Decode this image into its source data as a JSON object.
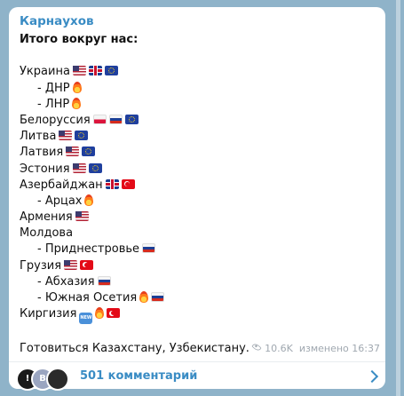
{
  "post": {
    "author": "Карнаухов",
    "lines": [
      {
        "text": "Итого вокруг нас:",
        "style": "bold",
        "marks": []
      },
      {
        "text": "",
        "style": "normal",
        "marks": []
      },
      {
        "text": "Украина",
        "style": "normal",
        "marks": [
          "us",
          "uk",
          "eu"
        ]
      },
      {
        "text": "- ДНР",
        "style": "sub",
        "marks": [
          "fire"
        ]
      },
      {
        "text": "- ЛНР",
        "style": "sub",
        "marks": [
          "fire"
        ]
      },
      {
        "text": "Белоруссия",
        "style": "normal",
        "marks": [
          "pl",
          "ru",
          "eu"
        ]
      },
      {
        "text": "Литва",
        "style": "normal",
        "marks": [
          "us",
          "eu"
        ]
      },
      {
        "text": "Латвия",
        "style": "normal",
        "marks": [
          "us",
          "eu"
        ]
      },
      {
        "text": "Эстония",
        "style": "normal",
        "marks": [
          "us",
          "eu"
        ]
      },
      {
        "text": "Азербайджан",
        "style": "normal",
        "marks": [
          "uk",
          "tr"
        ]
      },
      {
        "text": "- Арцах",
        "style": "sub",
        "marks": [
          "fire"
        ]
      },
      {
        "text": "Армения",
        "style": "normal",
        "marks": [
          "us"
        ]
      },
      {
        "text": "Молдова",
        "style": "normal",
        "marks": []
      },
      {
        "text": "- Приднестровье",
        "style": "sub",
        "marks": [
          "ru"
        ]
      },
      {
        "text": "Грузия",
        "style": "normal",
        "marks": [
          "us",
          "tr"
        ]
      },
      {
        "text": "- Абхазия",
        "style": "sub",
        "marks": [
          "ru"
        ]
      },
      {
        "text": "- Южная Осетия",
        "style": "sub",
        "marks": [
          "fire",
          "ru"
        ]
      },
      {
        "text": "Киргизия",
        "style": "normal",
        "marks": [
          "new",
          "fire",
          "tr"
        ]
      },
      {
        "text": "",
        "style": "normal",
        "marks": []
      }
    ],
    "last_line": "Готовиться Казахстану, Узбекистану.",
    "views": "10.6K",
    "edited": "изменено 16:37"
  },
  "comments": {
    "label": "501 комментарий",
    "avatar_letters": [
      "!",
      "B",
      ""
    ]
  },
  "icons": {
    "views": "eye-icon",
    "open_comments": "chevron-right-icon",
    "new_badge": "NEW"
  },
  "colors": {
    "accent": "#3a8cc4",
    "background": "#8fb3c9",
    "meta": "#a0a8b0"
  }
}
